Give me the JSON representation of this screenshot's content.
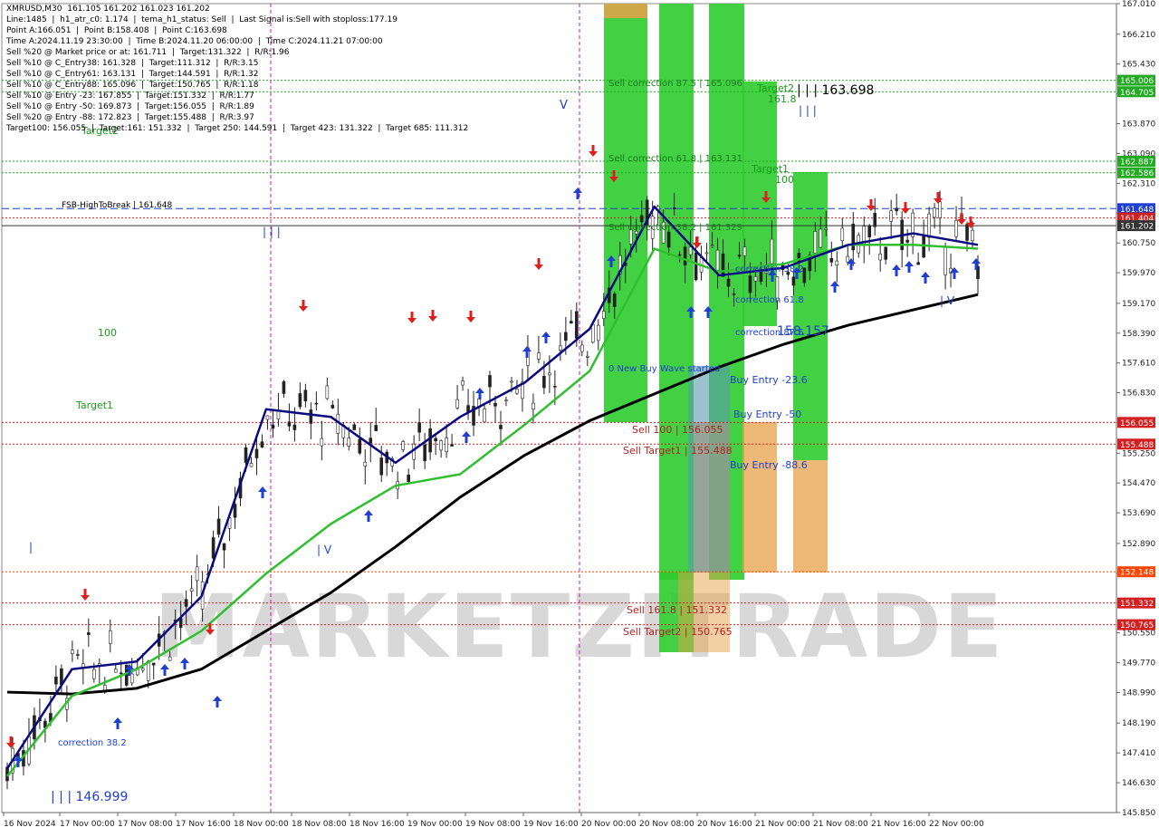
{
  "info": {
    "lines": [
      "XMRUSD,M30  161.105 161.202 161.023 161.202",
      "Line:1485  |  h1_atr_c0: 1.174  |  tema_h1_status: Sell  |  Last Signal is:Sell with stoploss:177.19",
      "Point A:166.051  |  Point B:158.408  |  Point C:163.698",
      "Time A:2024.11.19 23:30:00  |  Time B:2024.11.20 06:00:00  |  Time C:2024.11.21 07:00:00",
      "Sell %20 @ Market price or at: 161.711  |  Target:131.322  |  R/R:1.96",
      "Sell %10 @ C_Entry38: 161.328  |  Target:111.312  |  R/R:3.15",
      "Sell %10 @ C_Entry61: 163.131  |  Target:144.591  |  R/R:1.32",
      "Sell %10 @ C_Entry88: 165.096  |  Target:150.765  |  R/R:1.18",
      "Sell %10 @ Entry -23: 167.855  |  Target:151.332  |  R/R:1.77",
      "Sell %10 @ Entry -50: 169.873  |  Target:156.055  |  R/R:1.89",
      "Sell %20 @ Entry -88: 172.823  |  Target:155.488  |  R/R:3.97",
      "Target100: 156.055  |  Target:161: 151.332  |  Target 250: 144.591  |  Target 423: 131.322  |  Target 685: 111.312"
    ]
  },
  "watermark": "MARKETZITRADE",
  "chart_data": {
    "type": "line",
    "symbol": "XMRUSD,M30",
    "ylim": [
      145.85,
      167.01
    ],
    "y_ticks": [
      167.01,
      166.21,
      165.43,
      164.65,
      163.87,
      163.09,
      162.31,
      161.53,
      160.75,
      159.97,
      159.17,
      158.39,
      157.61,
      156.83,
      156.05,
      155.25,
      154.47,
      153.69,
      152.89,
      152.11,
      151.33,
      150.55,
      149.77,
      148.99,
      148.19,
      147.41,
      146.63,
      145.85
    ],
    "x_ticks": [
      "16 Nov 2024",
      "17 Nov 00:00",
      "17 Nov 08:00",
      "17 Nov 16:00",
      "18 Nov 00:00",
      "18 Nov 08:00",
      "18 Nov 16:00",
      "19 Nov 00:00",
      "19 Nov 08:00",
      "19 Nov 16:00",
      "20 Nov 00:00",
      "20 Nov 08:00",
      "20 Nov 16:00",
      "21 Nov 00:00",
      "21 Nov 08:00",
      "21 Nov 16:00",
      "22 Nov 00:00"
    ],
    "price_tags": [
      {
        "value": 165.006,
        "label": "165.006",
        "color": "#22aa22"
      },
      {
        "value": 164.705,
        "label": "164.705",
        "color": "#22aa22"
      },
      {
        "value": 162.887,
        "label": "162.887",
        "color": "#22aa22"
      },
      {
        "value": 162.586,
        "label": "162.586",
        "color": "#22aa22"
      },
      {
        "value": 161.648,
        "label": "161.648",
        "color": "#1f3fd0"
      },
      {
        "value": 161.404,
        "label": "161.404",
        "color": "#d21f1f"
      },
      {
        "value": 161.202,
        "label": "161.202",
        "color": "#333333"
      },
      {
        "value": 156.055,
        "label": "156.055",
        "color": "#d21f1f"
      },
      {
        "value": 155.488,
        "label": "155.488",
        "color": "#d21f1f"
      },
      {
        "value": 152.148,
        "label": "152.148",
        "color": "#ff4500"
      },
      {
        "value": 151.332,
        "label": "151.332",
        "color": "#d21f1f"
      },
      {
        "value": 150.765,
        "label": "150.765",
        "color": "#d21f1f"
      }
    ],
    "annotations": [
      {
        "text": "FSB-HighToBreak | 161.648",
        "color": "#000000"
      },
      {
        "text": "Sell correction 87.5 | 165.096",
        "color": "#1a7a1a"
      },
      {
        "text": "Sell correction 61.8 | 163.131",
        "color": "#1a7a1a"
      },
      {
        "text": "Sell correction 38.2 | 161.329",
        "color": "#1a7a1a"
      },
      {
        "text": "Target2",
        "color": "#1a9a1a"
      },
      {
        "text": "161.8",
        "color": "#1a9a1a"
      },
      {
        "text": "| | | 163.698",
        "color": "#000000"
      },
      {
        "text": "Target1",
        "color": "#1a9a1a"
      },
      {
        "text": "100",
        "color": "#1a9a1a"
      },
      {
        "text": "correction 38.2",
        "color": "#1f3fd0"
      },
      {
        "text": "correction 61.8",
        "color": "#1f3fd0"
      },
      {
        "text": "correction 87.5",
        "color": "#1f3fd0"
      },
      {
        "text": "158.157",
        "color": "#1f3fd0"
      },
      {
        "text": "0 New Buy Wave started",
        "color": "#1f3fd0"
      },
      {
        "text": "Buy Entry -23.6",
        "color": "#1f3fd0"
      },
      {
        "text": "Buy Entry -50",
        "color": "#1f3fd0"
      },
      {
        "text": "Buy Entry -88.6",
        "color": "#1f3fd0"
      },
      {
        "text": "Sell 100 | 156.055",
        "color": "#b22222"
      },
      {
        "text": "Sell Target1 | 155.488",
        "color": "#b22222"
      },
      {
        "text": "Sell 161.8 | 151.332",
        "color": "#b22222"
      },
      {
        "text": "Sell Target2 | 150.765",
        "color": "#b22222"
      },
      {
        "text": "Target2",
        "color": "#1a9a1a"
      },
      {
        "text": "100",
        "color": "#1a9a1a"
      },
      {
        "text": "Target1",
        "color": "#1a9a1a"
      },
      {
        "text": "correction 38.2",
        "color": "#1f3fd0"
      },
      {
        "text": "| | | 146.999",
        "color": "#1f3fd0"
      },
      {
        "text": "V",
        "color": "#1f3fd0"
      },
      {
        "text": "| | |",
        "color": "#1f3fd0"
      },
      {
        "text": "| V",
        "color": "#1f3fd0"
      },
      {
        "text": "| | |",
        "color": "#1f3fd0"
      },
      {
        "text": "| V",
        "color": "#1f3fd0"
      },
      {
        "text": "|",
        "color": "#1f3fd0"
      }
    ],
    "series": [
      {
        "name": "",
        "color": "#000000",
        "values": [
          149.0,
          148.95,
          149.1,
          149.6,
          150.6,
          151.6,
          152.8,
          154.1,
          155.2,
          156.1,
          156.8,
          157.5,
          158.1,
          158.6,
          159.0,
          159.4
        ]
      },
      {
        "name": "",
        "color": "#2fbf2f",
        "values": [
          146.8,
          148.9,
          149.6,
          150.6,
          152.1,
          153.4,
          154.4,
          154.7,
          156.0,
          157.4,
          160.6,
          160.0,
          160.2,
          160.7,
          160.7,
          160.6
        ]
      },
      {
        "name": "",
        "color": "#0a0a80",
        "values": [
          147.0,
          149.6,
          149.8,
          151.5,
          156.4,
          156.2,
          155.0,
          156.2,
          157.1,
          158.5,
          161.7,
          159.9,
          160.1,
          160.7,
          161.0,
          160.7
        ]
      }
    ]
  }
}
